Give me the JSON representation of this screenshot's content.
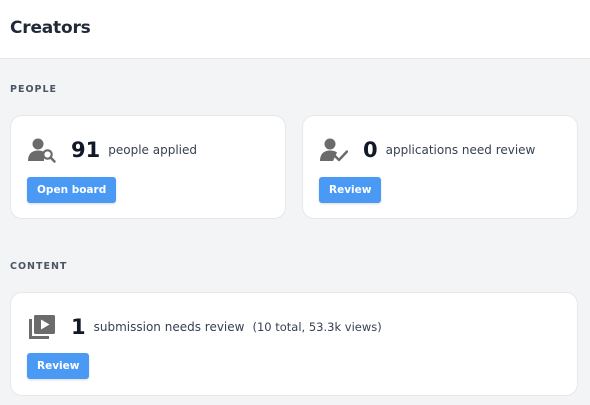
{
  "header": {
    "title": "Creators"
  },
  "sections": {
    "people": {
      "label": "PEOPLE",
      "applied": {
        "icon": "user-search-icon",
        "count": "91",
        "text": "people applied",
        "button": "Open board"
      },
      "review": {
        "icon": "user-check-icon",
        "count": "0",
        "text": "applications need review",
        "button": "Review"
      }
    },
    "content": {
      "label": "CONTENT",
      "submission": {
        "icon": "video-library-icon",
        "count": "1",
        "text": "submission needs review",
        "subtext": "(10 total, 53.3k views)",
        "button": "Review"
      }
    }
  },
  "colors": {
    "accent": "#4a9af5",
    "background": "#f3f4f6",
    "card": "#ffffff",
    "icon": "#6b6b6b"
  }
}
